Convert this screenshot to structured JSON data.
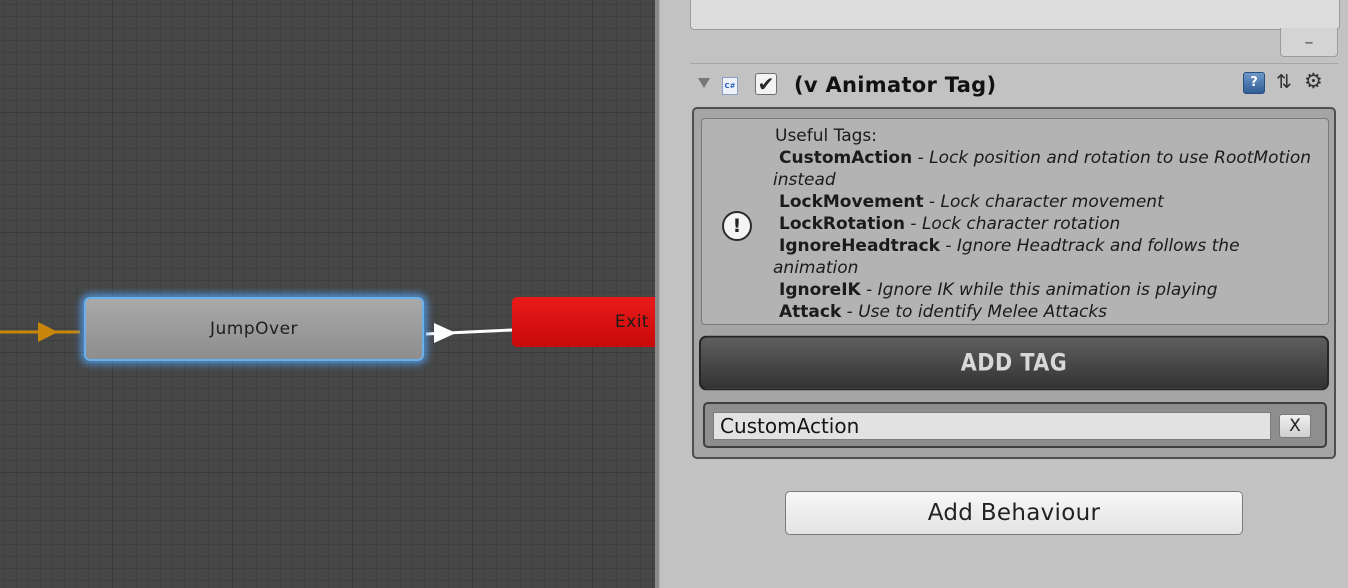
{
  "graph": {
    "states": {
      "jump_over": "JumpOver",
      "exit": "Exit"
    },
    "colors": {
      "background": "#474747",
      "entry_transition": "#c8860a",
      "transition": "#ffffff",
      "selected_outline": "#6bb0ea",
      "exit_node": "#e01010"
    }
  },
  "inspector": {
    "previous_list": {
      "remove_label": "–"
    },
    "component": {
      "title": "(v Animator Tag)",
      "enabled": true,
      "enabled_glyph": "✔",
      "script_icon_label": "C#",
      "icons": [
        "foldout-arrow-icon",
        "script-icon",
        "help-book-icon",
        "preset-icon",
        "gear-icon"
      ]
    },
    "help_box": {
      "icon": "info-exclamation-icon",
      "icon_glyph": "!",
      "header": "Useful Tags:",
      "tags": [
        {
          "name": "CustomAction",
          "sep": " - ",
          "desc": "Lock position and rotation to use RootMotion instead"
        },
        {
          "name": "LockMovement",
          "sep": " - ",
          "desc": "Lock character movement"
        },
        {
          "name": "LockRotation",
          "sep": " - ",
          "desc": "Lock character rotation"
        },
        {
          "name": "IgnoreHeadtrack",
          "sep": " - ",
          "desc": "Ignore Headtrack and follows the animation"
        },
        {
          "name": "IgnoreIK",
          "sep": " - ",
          "desc": "Ignore IK while this animation is playing"
        },
        {
          "name": "Attack",
          "sep": " - ",
          "desc": "Use to identify Melee Attacks"
        }
      ]
    },
    "add_tag_label": "ADD TAG",
    "tag_entries": [
      {
        "value": "CustomAction",
        "remove_label": "X"
      }
    ],
    "add_behaviour_label": "Add Behaviour"
  }
}
